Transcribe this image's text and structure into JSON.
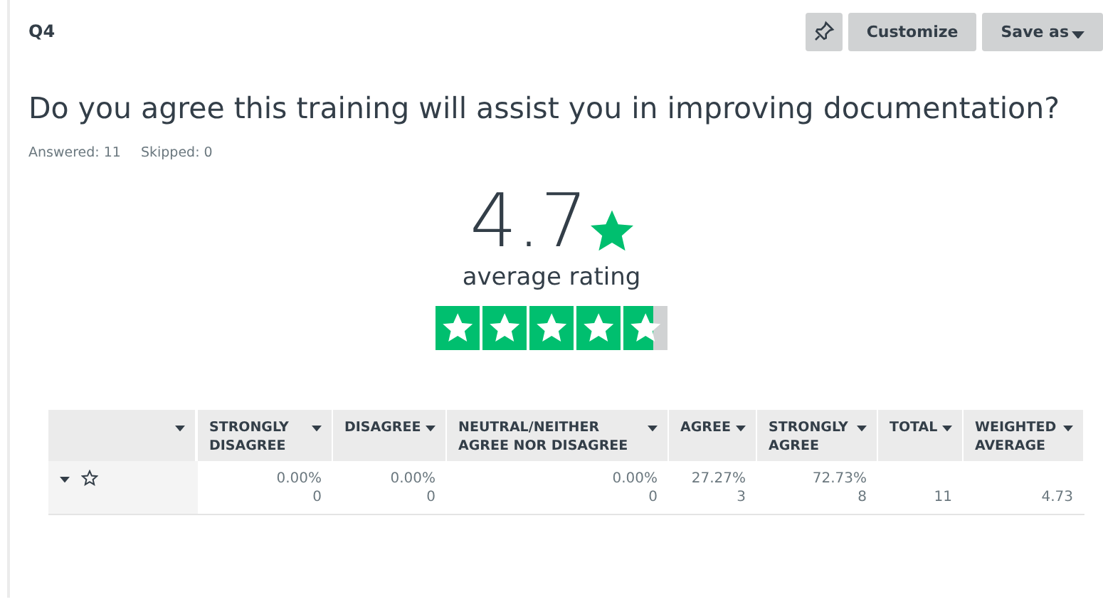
{
  "question": {
    "number": "Q4",
    "title": "Do you agree this training will assist you in improving documentation?",
    "answered": "Answered: 11",
    "skipped": "Skipped: 0"
  },
  "toolbar": [
    "Customize",
    "Save as"
  ],
  "rating": {
    "value": "4.7",
    "label": "average rating",
    "level": 0.94
  },
  "table": {
    "columns": [
      {
        "label": "STRONGLY DISAGREE"
      },
      {
        "label": "DISAGREE"
      },
      {
        "label": "NEUTRAL/NEITHER AGREE NOR DISAGREE"
      },
      {
        "label": "AGREE"
      },
      {
        "label": "STRONGLY AGREE"
      },
      {
        "label": "TOTAL"
      },
      {
        "label": "WEIGHTED AVERAGE"
      }
    ],
    "rows": [
      {
        "cells": [
          {
            "percent": "0.00%",
            "count": "0"
          },
          {
            "percent": "0.00%",
            "count": "0"
          },
          {
            "percent": "0.00%",
            "count": "0"
          },
          {
            "percent": "27.27%",
            "count": "3"
          },
          {
            "percent": "72.73%",
            "count": "8"
          },
          {
            "count": "11"
          },
          {
            "count": "4.73"
          }
        ]
      }
    ]
  }
}
